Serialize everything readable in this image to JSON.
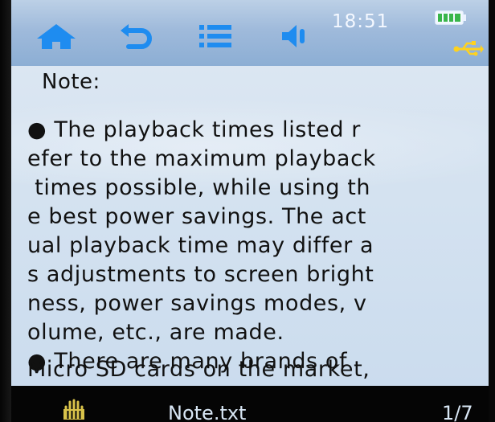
{
  "status": {
    "clock": "18:51",
    "battery_icon": "battery-full-icon",
    "usb_icon": "usb-icon"
  },
  "toolbar": {
    "icons": [
      "home-icon",
      "back-icon",
      "list-icon",
      "volume-icon"
    ]
  },
  "document": {
    "heading": "Note:",
    "lines": [
      "● The playback times listed r",
      "efer to the maximum playback",
      " times possible, while using th",
      "e best power savings. The act",
      "ual playback time may differ a",
      "s adjustments to screen bright",
      "ness, power savings modes, v",
      "olume, etc., are made.",
      "● There are many brands of",
      "Micro SD cards on the market,"
    ]
  },
  "footer": {
    "filename": "Note.txt",
    "page": "1/7",
    "hand_icon": "hand-icon"
  },
  "colors": {
    "toolbar_bg": "#9fbadb",
    "icon_blue": "#1e8cf0",
    "content_bg": "#d4e2f0",
    "footer_bg": "#050505"
  }
}
